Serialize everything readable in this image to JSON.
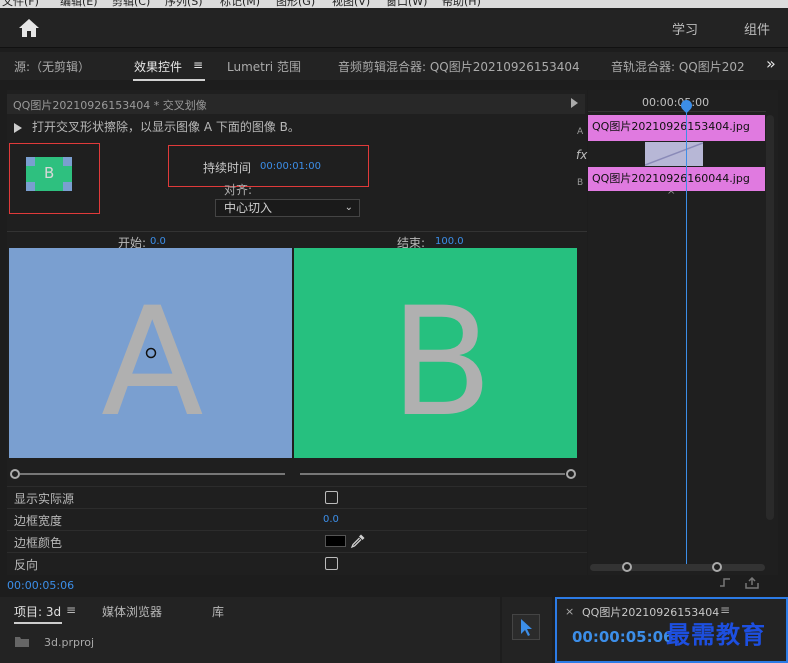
{
  "menubar": {
    "items": [
      "文件(F)",
      "编辑(E)",
      "剪辑(C)",
      "序列(S)",
      "标记(M)",
      "图形(G)",
      "视图(V)",
      "窗口(W)",
      "帮助(H)"
    ]
  },
  "topbar": {
    "workspaces": [
      "学习",
      "组件"
    ]
  },
  "panel_tabs": {
    "source": "源:（无剪辑）",
    "effect_controls": "效果控件",
    "effect_controls_menu": "≡",
    "lumetri": "Lumetri 范围",
    "audio_clip_mixer": "音频剪辑混合器: QQ图片20210926153404",
    "audio_track_mixer": "音轨混合器: QQ图片202",
    "overflow": "»"
  },
  "effect_controls": {
    "header": "QQ图片20210926153404 * 交叉划像",
    "description": "打开交叉形状擦除，以显示图像 A 下面的图像 B。",
    "thumbnail_letter": "B",
    "duration_label": "持续时间",
    "duration_value": "00:00:01:00",
    "align_label": "对齐:",
    "align_value": "中心切入",
    "start_label": "开始:",
    "start_value": "0.0",
    "end_label": "结束:",
    "end_value": "100.0",
    "preview_a_letter": "A",
    "preview_b_letter": "B",
    "show_actual_sources": "显示实际源",
    "border_width_label": "边框宽度",
    "border_width_value": "0.0",
    "border_color_label": "边框颜色",
    "border_color": "#000000",
    "reverse_label": "反向",
    "timecode": "00:00:05:06"
  },
  "mini_timeline": {
    "ruler_time": "00:00:05:00",
    "track_a_label": "A",
    "track_b_label": "B",
    "fx_label": "fx",
    "clip_a": "QQ图片20210926153404.jpg",
    "clip_b": "QQ图片20210926160044.jpg",
    "clip_color": "#e07ae0",
    "transition_color": "#b7b7d6",
    "playhead_color": "#3c8ee8"
  },
  "bottom": {
    "project_tab": "项目: 3d",
    "project_menu": "≡",
    "media_browser_tab": "媒体浏览器",
    "library_tab": "库",
    "project_file": "3d.prproj",
    "sequence_close": "×",
    "sequence_title": "QQ图片20210926153404",
    "sequence_menu": "≡",
    "sequence_time": "00:00:05:06"
  },
  "watermark": "最需教育",
  "colors": {
    "accent_blue": "#3c8ee8",
    "preview_a_bg": "#7a9fd0",
    "preview_b_bg": "#26c07f",
    "highlight_box": "#e03a3a"
  }
}
